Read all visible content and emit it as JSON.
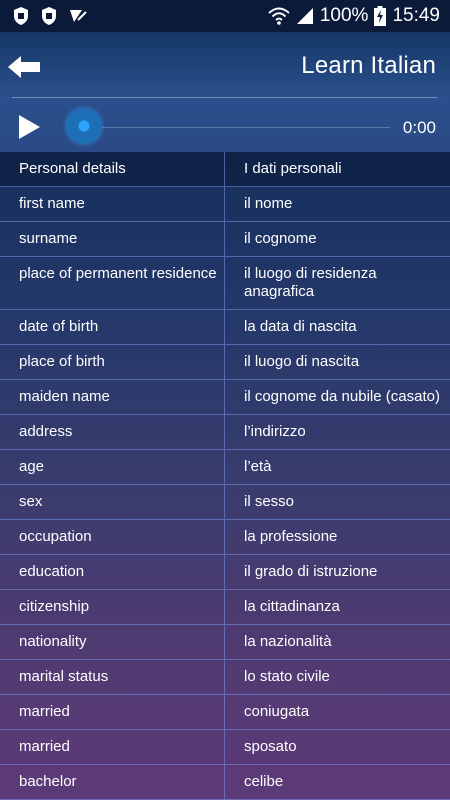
{
  "status_bar": {
    "left_icons": [
      "shield-icon",
      "shield-icon",
      "check-icon"
    ],
    "battery_percent": "100%",
    "time": "15:49",
    "right_icons": [
      "wifi-icon",
      "signal-icon",
      "battery-charging-icon"
    ]
  },
  "header": {
    "title": "Learn Italian",
    "back_icon": "back-arrow-icon"
  },
  "player": {
    "play_icon": "play-icon",
    "time": "0:00",
    "progress": 0
  },
  "table": {
    "header": {
      "en": "Personal details",
      "it": "I dati personali"
    },
    "rows": [
      {
        "en": "first name",
        "it": "il nome"
      },
      {
        "en": "surname",
        "it": "il cognome"
      },
      {
        "en": "place of permanent residence",
        "it": "il luogo di residenza anagrafica"
      },
      {
        "en": "date of birth",
        "it": "la data di nascita"
      },
      {
        "en": "place of birth",
        "it": "il luogo di nascita"
      },
      {
        "en": "maiden name",
        "it": "il cognome da nubile (casato)"
      },
      {
        "en": "address",
        "it": "l’indirizzo"
      },
      {
        "en": "age",
        "it": "l’età"
      },
      {
        "en": "sex",
        "it": "il sesso"
      },
      {
        "en": "occupation",
        "it": "la professione"
      },
      {
        "en": "education",
        "it": "il grado di istruzione"
      },
      {
        "en": "citizenship",
        "it": "la cittadinanza"
      },
      {
        "en": "nationality",
        "it": "la nazionalità"
      },
      {
        "en": "marital status",
        "it": "lo stato civile"
      },
      {
        "en": "married",
        "it": "coniugata"
      },
      {
        "en": "married",
        "it": "sposato"
      },
      {
        "en": "bachelor",
        "it": "celibe"
      }
    ]
  }
}
